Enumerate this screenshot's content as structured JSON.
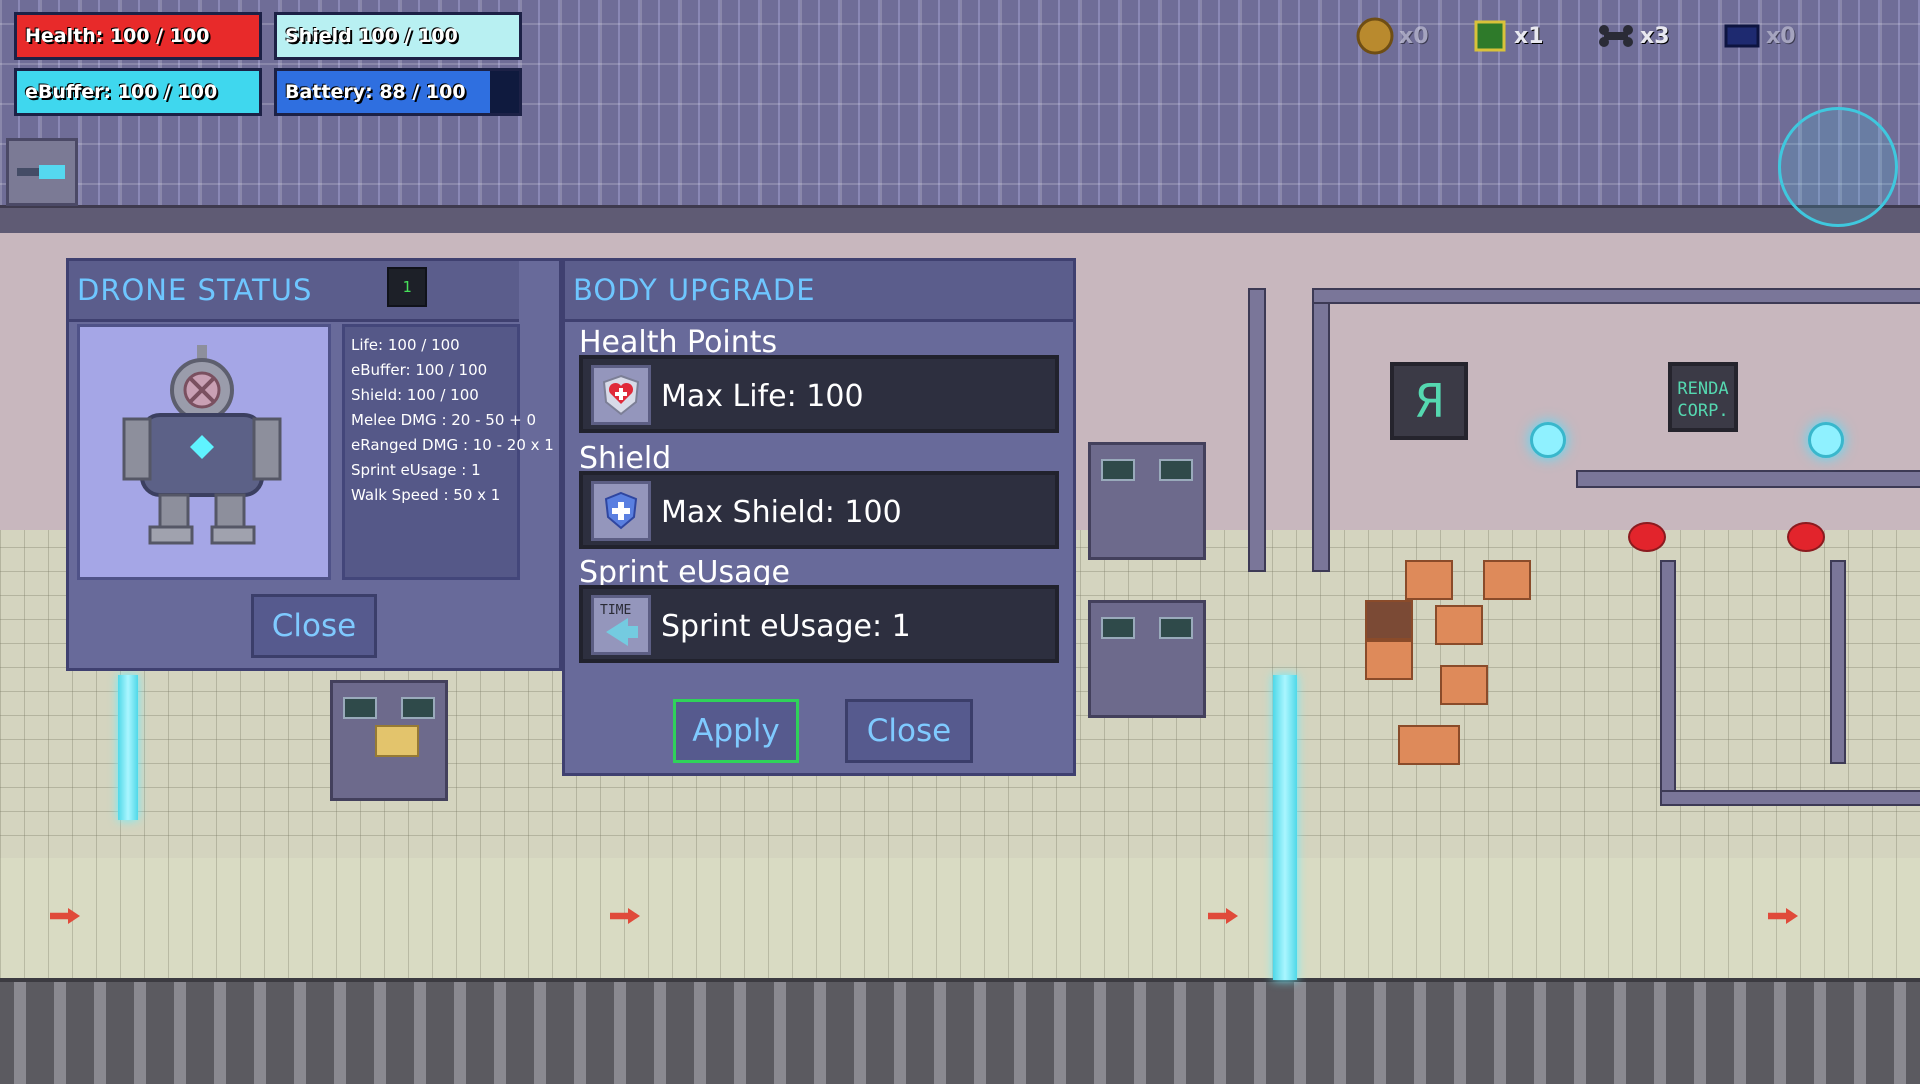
{
  "hud": {
    "health": {
      "label": "Health: 100 / 100",
      "color": "#e82a2a",
      "level": 1.0
    },
    "shield": {
      "label": "Shield 100 / 100",
      "color": "#b8f0f2",
      "level": 1.0
    },
    "ebuffer": {
      "label": "eBuffer: 100 / 100",
      "color": "#3fd7ee",
      "level": 1.0
    },
    "battery": {
      "label": "Battery: 88 / 100",
      "color": "#2f6fe0",
      "level": 0.88
    }
  },
  "inventory": [
    {
      "icon": "gold-coin-icon",
      "count": "x0"
    },
    {
      "icon": "microchip-icon",
      "count": "x1"
    },
    {
      "icon": "bone-part-icon",
      "count": "x3"
    },
    {
      "icon": "blue-cell-icon",
      "count": "x0"
    }
  ],
  "drone_status": {
    "title": "DRONE STATUS",
    "level": "1",
    "stats": [
      "Life: 100 / 100",
      "eBuffer: 100 / 100",
      "Shield: 100 / 100",
      "Melee DMG : 20 - 50 + 0",
      "eRanged DMG : 10 - 20 x 1",
      "Sprint eUsage : 1",
      "Walk Speed : 50 x 1"
    ],
    "close_label": "Close"
  },
  "body_upgrade": {
    "title": "BODY UPGRADE",
    "sections": [
      {
        "label": "Health Points",
        "icon": "heart-shield-icon",
        "value": "Max Life: 100"
      },
      {
        "label": "Shield",
        "icon": "shield-plus-icon",
        "value": "Max Shield: 100"
      },
      {
        "label": "Sprint eUsage",
        "icon": "time-icon",
        "value": "Sprint eUsage: 1",
        "icon_text": "TIME"
      }
    ],
    "apply_label": "Apply",
    "close_label": "Close"
  },
  "signs": {
    "r_sign": "Я",
    "corp_sign": "RENDA CORP."
  }
}
